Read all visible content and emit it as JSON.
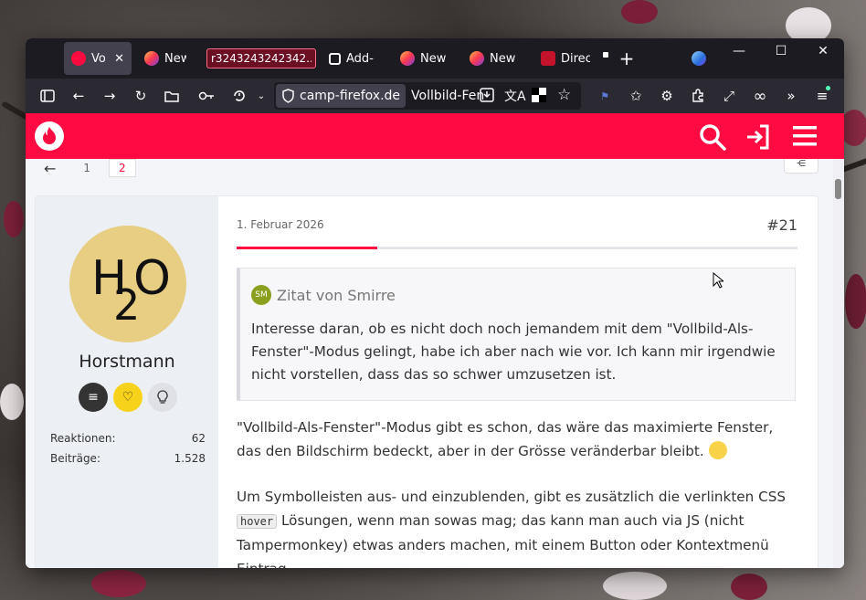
{
  "tabs": [
    {
      "label": "Voll",
      "active": true,
      "favicon": "camp-firefox-icon"
    },
    {
      "label": "New T",
      "favicon": "firefox-icon"
    },
    {
      "label": "r3243243242342...",
      "favicon": "none"
    },
    {
      "label": "Add-o",
      "favicon": "puzzle-icon"
    },
    {
      "label": "New T",
      "favicon": "firefox-icon"
    },
    {
      "label": "New T",
      "favicon": "firefox-icon"
    },
    {
      "label": "Direct",
      "favicon": "dragon-icon"
    }
  ],
  "tab_close": "✕",
  "new_tab": "+",
  "window_controls": {
    "minimize": "—",
    "maximize": "☐",
    "close": "✕"
  },
  "url": {
    "site": "camp-firefox.de",
    "title": "Vollbild-Fen"
  },
  "pager": {
    "prev": "←",
    "page1": "1",
    "page2": "2"
  },
  "post": {
    "date": "1. Februar 2026",
    "number": "#21",
    "progress": 0.25,
    "quote": {
      "avatar": "SM",
      "header": "Zitat von Smirre",
      "text": "Interesse daran, ob es nicht doch noch jemandem mit dem \"Vollbild-Als-Fenster\"-Modus gelingt, habe ich aber nach wie vor. Ich kann mir irgendwie nicht vorstellen, dass das so schwer umzusetzen ist."
    },
    "body1": "\"Vollbild-Als-Fenster\"-Modus gibt es schon, das wäre das maximierte Fenster, das den Bildschirm bedeckt, aber in der Grösse veränderbar bleibt.",
    "body2_before": "Um Symbolleisten aus- und einzublenden, gibt es zusätzlich die verlinkten CSS",
    "body2_code": "hover",
    "body2_after": "Lösungen, wenn man sowas mag; das kann man auch via JS (nicht Tampermonkey) etwas anders machen, mit einem Button oder Kontextmenü Eintrag."
  },
  "author": {
    "name": "Horstmann",
    "avatar_text": {
      "h": "H",
      "two": "2",
      "o": "O"
    },
    "badges": [
      "list-icon",
      "heart-icon",
      "lightbulb-icon"
    ],
    "stats": [
      {
        "label": "Reaktionen:",
        "value": "62"
      },
      {
        "label": "Beiträge:",
        "value": "1.528"
      }
    ]
  },
  "colors": {
    "brand": "#ff0a41",
    "avatar_bg": "#e8ce82"
  }
}
